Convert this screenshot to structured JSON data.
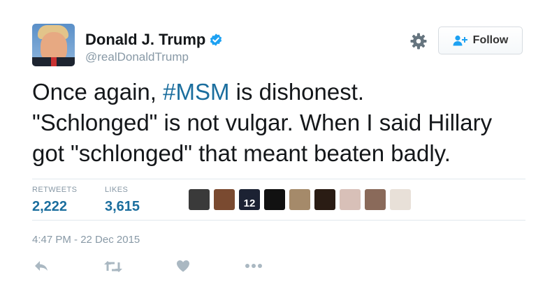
{
  "user": {
    "name": "Donald J. Trump",
    "handle": "@realDonaldTrump",
    "verified": true
  },
  "follow_button": {
    "label": "Follow"
  },
  "tweet": {
    "lines": [
      {
        "before": "Once again, ",
        "hashtag": "#MSM",
        "after": " is dishonest."
      },
      {
        "text": "\"Schlonged\" is not vulgar. When I said Hillary"
      },
      {
        "text": "got \"schlonged\" that meant beaten badly."
      }
    ]
  },
  "stats": {
    "retweets": {
      "label": "RETWEETS",
      "value": "2,222"
    },
    "likes": {
      "label": "LIKES",
      "value": "3,615"
    }
  },
  "likers": [
    {
      "color": "#3a3a3a"
    },
    {
      "color": "#7a4a30"
    },
    {
      "color": "#1c2233",
      "text": "12"
    },
    {
      "color": "#111111"
    },
    {
      "color": "#a58a6a"
    },
    {
      "color": "#2a1c14"
    },
    {
      "color": "#d8c0b8"
    },
    {
      "color": "#8a6a5a"
    },
    {
      "color": "#e8e0d8"
    }
  ],
  "timestamp": "4:47 PM - 22 Dec 2015",
  "actions": [
    "reply-icon",
    "retweet-icon",
    "like-icon",
    "more-icon"
  ],
  "colors": {
    "link": "#1b6e9e",
    "muted": "#8899a6",
    "verified": "#1da1f2",
    "icon": "#aab8c2"
  }
}
